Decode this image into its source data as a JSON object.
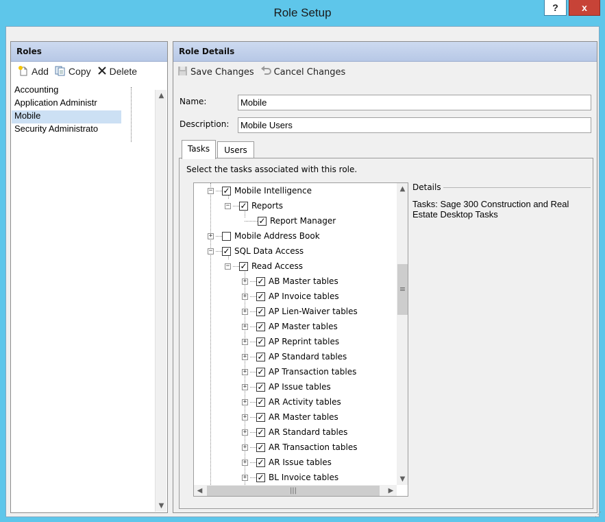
{
  "window": {
    "title": "Role Setup",
    "help_label": "?",
    "close_label": "x"
  },
  "roles": {
    "header": "Roles",
    "toolbar": {
      "add": "Add",
      "copy": "Copy",
      "delete": "Delete"
    },
    "items": [
      "Accounting",
      "Application Administr",
      "Mobile",
      "Security Administrato"
    ],
    "selected": "Mobile"
  },
  "details": {
    "header": "Role Details",
    "toolbar": {
      "save": "Save Changes",
      "cancel": "Cancel Changes"
    },
    "name_label": "Name:",
    "name_value": "Mobile",
    "description_label": "Description:",
    "description_value": "Mobile Users",
    "tabs": [
      "Tasks",
      "Users"
    ],
    "active_tab": "Tasks",
    "instructions": "Select the tasks associated with this role.",
    "tree": [
      {
        "label": "Mobile Intelligence",
        "checked": true,
        "expander": "-"
      },
      {
        "label": "Reports",
        "checked": true,
        "expander": "-"
      },
      {
        "label": "Report Manager",
        "checked": true,
        "expander": ""
      },
      {
        "label": "Mobile Address Book",
        "checked": false,
        "expander": "+"
      },
      {
        "label": "SQL Data Access",
        "checked": true,
        "expander": "-"
      },
      {
        "label": "Read Access",
        "checked": true,
        "expander": "-"
      },
      {
        "label": "AB Master tables",
        "checked": true,
        "expander": "+"
      },
      {
        "label": "AP Invoice tables",
        "checked": true,
        "expander": "+"
      },
      {
        "label": "AP Lien-Waiver tables",
        "checked": true,
        "expander": "+"
      },
      {
        "label": "AP Master tables",
        "checked": true,
        "expander": "+"
      },
      {
        "label": "AP Reprint tables",
        "checked": true,
        "expander": "+"
      },
      {
        "label": "AP Standard tables",
        "checked": true,
        "expander": "+"
      },
      {
        "label": "AP Transaction tables",
        "checked": true,
        "expander": "+"
      },
      {
        "label": "AP Issue tables",
        "checked": true,
        "expander": "+"
      },
      {
        "label": "AR Activity tables",
        "checked": true,
        "expander": "+"
      },
      {
        "label": "AR Master tables",
        "checked": true,
        "expander": "+"
      },
      {
        "label": "AR Standard tables",
        "checked": true,
        "expander": "+"
      },
      {
        "label": "AR Transaction tables",
        "checked": true,
        "expander": "+"
      },
      {
        "label": "AR Issue tables",
        "checked": true,
        "expander": "+"
      },
      {
        "label": "BL Invoice tables",
        "checked": true,
        "expander": "+"
      }
    ],
    "details_legend": "Details",
    "details_text": "Tasks: Sage 300 Construction and Real Estate Desktop Tasks"
  },
  "icons": {
    "add": "new-document-icon",
    "copy": "copy-icon",
    "delete": "delete-x-icon",
    "save": "save-disk-icon",
    "cancel": "undo-arrow-icon"
  },
  "colors": {
    "titlebar": "#5ec6ea",
    "close_button": "#c74337",
    "header_gradient": "#cddaf0",
    "selected_row": "#cce0f4"
  }
}
